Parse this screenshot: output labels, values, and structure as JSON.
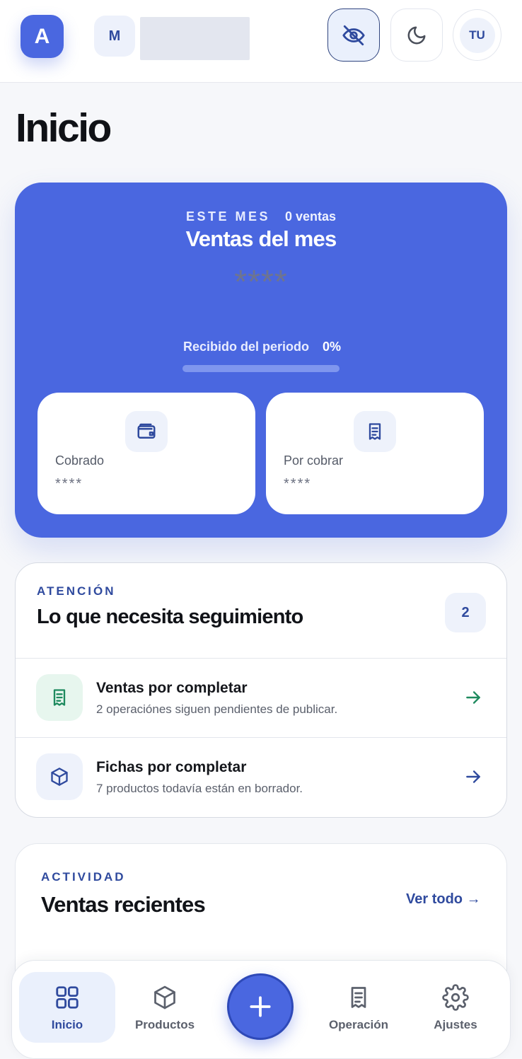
{
  "header": {
    "app_initial": "A",
    "workspace_initial": "M",
    "user_initials": "TU",
    "icons": [
      "eye-off-icon",
      "moon-icon"
    ]
  },
  "page": {
    "title": "Inicio"
  },
  "sales": {
    "eyebrow": "ESTE MES",
    "count_text": "0 ventas",
    "title": "Ventas del mes",
    "amount_masked": "****",
    "received_label": "Recibido del periodo",
    "received_percent_text": "0%",
    "received_progress": 0,
    "collected_label": "Cobrado",
    "collected_value": "****",
    "pending_label": "Por cobrar",
    "pending_value": "****"
  },
  "attention": {
    "eyebrow": "ATENCIÓN",
    "title": "Lo que necesita seguimiento",
    "count": "2",
    "items": [
      {
        "title": "Ventas por completar",
        "subtitle": "2 operaciónes siguen pendientes de publicar.",
        "icon": "receipt-icon",
        "accent": "#1e8a5e"
      },
      {
        "title": "Fichas por completar",
        "subtitle": "7 productos todavía están en borrador.",
        "icon": "box-icon",
        "accent": "#2f4a9e"
      }
    ]
  },
  "activity": {
    "eyebrow": "ACTIVIDAD",
    "title": "Ventas recientes",
    "see_all": "Ver todo →"
  },
  "nav": {
    "items": [
      {
        "label": "Inicio",
        "icon": "grid-icon",
        "active": true
      },
      {
        "label": "Productos",
        "icon": "box-icon",
        "active": false
      },
      {
        "label": "Operación",
        "icon": "receipt-icon",
        "active": false
      },
      {
        "label": "Ajustes",
        "icon": "gear-icon",
        "active": false
      }
    ],
    "fab_icon": "plus-icon"
  },
  "colors": {
    "brand": "#4a67e0",
    "brand_dark": "#2f4a9e",
    "success": "#1e8a5e",
    "background": "#f6f7fa"
  }
}
